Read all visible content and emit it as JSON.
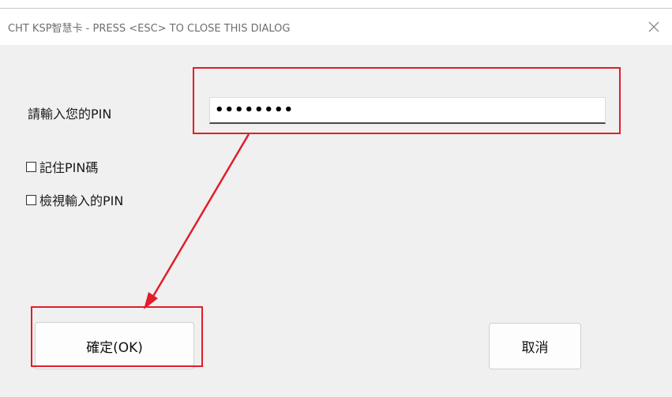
{
  "window": {
    "title": "CHT KSP智慧卡 -  PRESS <ESC> TO CLOSE THIS DIALOG",
    "close_icon_glyph": "✕"
  },
  "form": {
    "pin_label": "請輸入您的PIN",
    "pin_value": "••••••••",
    "remember_label": "記住PIN碼",
    "show_label": "檢視輸入的PIN",
    "remember_checked": false,
    "show_checked": false
  },
  "buttons": {
    "ok_label": "確定(OK)",
    "cancel_label": "取消"
  },
  "annotations": {
    "highlight_color": "#e11d2a",
    "arrow_from": "pin-input-highlight",
    "arrow_to": "ok-button-highlight"
  }
}
